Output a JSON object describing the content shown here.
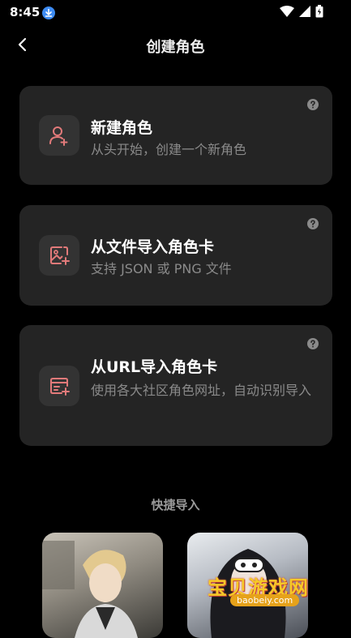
{
  "status_bar": {
    "time": "8:45"
  },
  "header": {
    "title": "创建角色"
  },
  "cards": [
    {
      "title": "新建角色",
      "subtitle": "从头开始，创建一个新角色",
      "icon": "add-user-icon"
    },
    {
      "title": "从文件导入角色卡",
      "subtitle": "支持 JSON 或 PNG 文件",
      "icon": "image-add-icon"
    },
    {
      "title": "从URL导入角色卡",
      "subtitle": "使用各大社区角色网址，自动识别导入",
      "icon": "browser-add-icon"
    }
  ],
  "quick_import": {
    "label": "快捷导入"
  },
  "watermark": {
    "text": "宝贝游戏网",
    "url": "baobeiy.com"
  },
  "colors": {
    "accent": "#e27a7a",
    "card_bg": "#242424",
    "icon_bg": "#333333",
    "subtitle": "#8a8a8a"
  }
}
